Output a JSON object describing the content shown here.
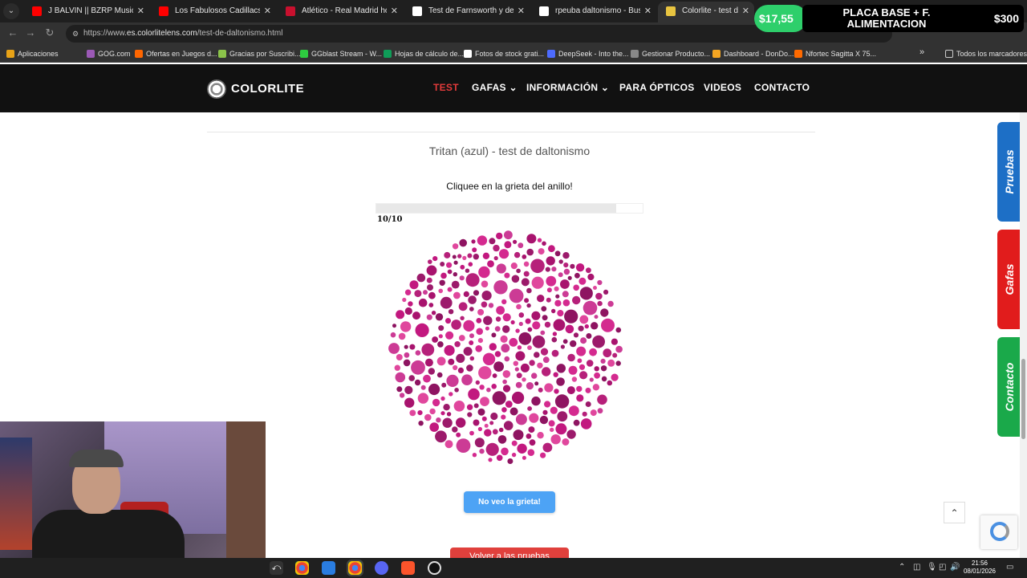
{
  "browser": {
    "tabs": [
      {
        "title": "J BALVIN || BZRP Music Sessions",
        "favicon_color": "#ff0000"
      },
      {
        "title": "Los Fabulosos Cadillacs - M",
        "favicon_color": "#ff0000"
      },
      {
        "title": "Atlético - Real Madrid hoy en d",
        "favicon_color": "#c8102e"
      },
      {
        "title": "Test de Farnsworth y detección",
        "favicon_color": "#ffffff"
      },
      {
        "title": "rpeuba daltonismo - Buscar co",
        "favicon_color": "#ffffff"
      },
      {
        "title": "Colorlite - test de daltonism",
        "favicon_color": "#e8c440",
        "active": true
      }
    ],
    "url_prefix": "https://www.",
    "url_domain": "es.colorlitelens.com",
    "url_path": "/test-de-daltonismo.html",
    "bookmarks": [
      {
        "label": "Aplicaciones",
        "color": "#e8a317"
      },
      {
        "label": "GOG.com",
        "color": "#9b59b6"
      },
      {
        "label": "Ofertas en Juegos d...",
        "color": "#ff6600"
      },
      {
        "label": "Gracias por Suscribi...",
        "color": "#8bc34a"
      },
      {
        "label": "GGblast Stream - W...",
        "color": "#2ecc40"
      },
      {
        "label": "Hojas de cálculo de...",
        "color": "#0f9d58"
      },
      {
        "label": "Fotos de stock grati...",
        "color": "#ffffff"
      },
      {
        "label": "DeepSeek - Into the...",
        "color": "#4d6bfe"
      },
      {
        "label": "Gestionar Producto...",
        "color": "#888888"
      },
      {
        "label": "Dashboard - DonDo...",
        "color": "#f5a623"
      },
      {
        "label": "Nfortec Sagitta X 75...",
        "color": "#ff6a00"
      }
    ],
    "all_bookmarks": "Todos los marcadores"
  },
  "ad": {
    "price_left": "$17,55",
    "title": "PLACA BASE + F. ALIMENTACION",
    "price_right": "$300"
  },
  "site": {
    "logo": "COLORLITE",
    "nav": [
      {
        "label": "TEST",
        "active": true
      },
      {
        "label": "GAFAS ⌄"
      },
      {
        "label": "INFORMACIÓN ⌄"
      },
      {
        "label": "PARA ÓPTICOS"
      },
      {
        "label": "VIDEOS"
      },
      {
        "label": "CONTACTO"
      }
    ]
  },
  "test": {
    "title": "Tritan (azul) - test de daltonismo",
    "instruction": "Cliquee  en la grieta  del anillo!",
    "progress_label": "10/10",
    "progress_fraction": 0.9,
    "plate_colors": [
      "#c2187f",
      "#a8136e",
      "#d42a8f",
      "#8e1461",
      "#e0479d",
      "#b6207a",
      "#9c1a6b",
      "#cc3b95"
    ],
    "btn_no_veo": "No veo la grieta!",
    "btn_volver": "Volver a las pruebas"
  },
  "side_tabs": [
    {
      "label": "Pruebas",
      "color": "#1d6fc6"
    },
    {
      "label": "Gafas",
      "color": "#e11c1c"
    },
    {
      "label": "Contacto",
      "color": "#1aa94a"
    }
  ],
  "taskbar": {
    "time": "21:56",
    "date": "08/01/2026"
  }
}
